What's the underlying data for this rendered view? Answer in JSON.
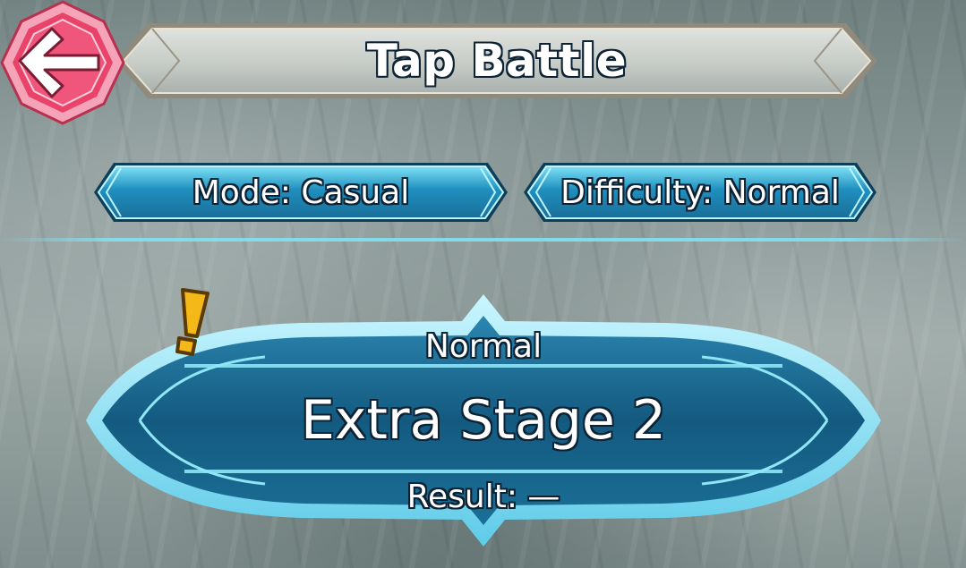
{
  "header": {
    "title": "Tap Battle"
  },
  "back_button": {
    "icon": "arrow-left-icon"
  },
  "options": {
    "mode_label": "Mode: Casual",
    "difficulty_label": "Difficulty: Normal"
  },
  "stage": {
    "difficulty": "Normal",
    "name": "Extra Stage 2",
    "result": "Result: —",
    "alert_icon": "exclamation-icon"
  },
  "colors": {
    "back_button": "#e9436a",
    "pill": "#2aa7cf",
    "card": "#1e6d96",
    "alert": "#f5b819"
  }
}
